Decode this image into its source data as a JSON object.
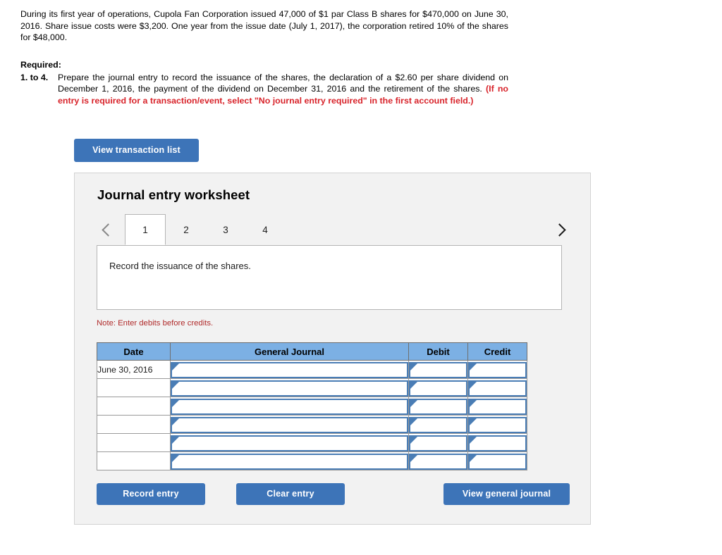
{
  "problem": {
    "statement": "During its first year of operations, Cupola Fan Corporation issued 47,000 of $1 par Class B shares for $470,000 on June 30, 2016. Share issue costs were $3,200. One year from the issue date (July 1, 2017), the corporation retired 10% of the shares for $48,000."
  },
  "required": {
    "label": "Required:",
    "item_number": "1. to 4.",
    "text": "Prepare the journal entry to record the issuance of the shares, the declaration of a $2.60 per share dividend on December 1, 2016, the payment of the dividend on December 31, 2016 and the retirement of the shares.",
    "warning": "(If no entry is required for a transaction/event, select \"No journal entry required\" in the first account field.)"
  },
  "toolbar": {
    "view_transaction_list_label": "View transaction list"
  },
  "worksheet": {
    "title": "Journal entry worksheet",
    "prev_icon": "chevron-left-icon",
    "next_icon": "chevron-right-icon",
    "tabs": [
      {
        "label": "1",
        "active": true
      },
      {
        "label": "2",
        "active": false
      },
      {
        "label": "3",
        "active": false
      },
      {
        "label": "4",
        "active": false
      }
    ],
    "transaction_description": "Record the issuance of the shares.",
    "note": "Note: Enter debits before credits.",
    "table": {
      "headers": [
        "Date",
        "General Journal",
        "Debit",
        "Credit"
      ],
      "rows": [
        {
          "date": "June 30, 2016",
          "general_journal": "",
          "debit": "",
          "credit": ""
        },
        {
          "date": "",
          "general_journal": "",
          "debit": "",
          "credit": ""
        },
        {
          "date": "",
          "general_journal": "",
          "debit": "",
          "credit": ""
        },
        {
          "date": "",
          "general_journal": "",
          "debit": "",
          "credit": ""
        },
        {
          "date": "",
          "general_journal": "",
          "debit": "",
          "credit": ""
        },
        {
          "date": "",
          "general_journal": "",
          "debit": "",
          "credit": ""
        }
      ]
    },
    "actions": {
      "record_entry_label": "Record entry",
      "clear_entry_label": "Clear entry",
      "view_general_journal_label": "View general journal"
    }
  },
  "colors": {
    "button_blue": "#3d74b8",
    "table_header_blue": "#7cb0e4",
    "field_border_blue": "#4a7db5",
    "warning_red": "#d8232a",
    "note_red": "#b02a2a",
    "panel_gray": "#f2f2f2"
  }
}
